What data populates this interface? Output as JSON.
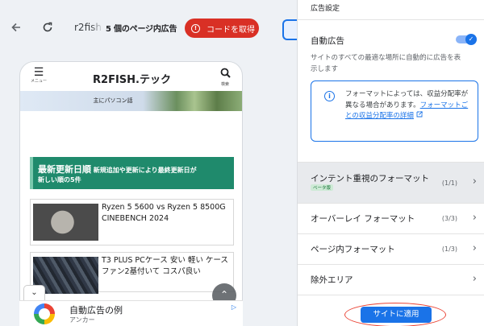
{
  "toolbar": {
    "back_icon": "arrow-left-icon",
    "reload_icon": "reload-icon",
    "url": "r2fish",
    "ads_count": "5 個のページ内広告",
    "get_code_label": "コードを取得",
    "get_code_color": "#d93025"
  },
  "site": {
    "menu_label": "メニュー",
    "title": "R2FISH.テック",
    "search_label": "検索",
    "banner_text": "主にパソコン話",
    "section_heading_big": "最新更新日順",
    "section_heading_rest": " 新規追加や更新により最終更新日が",
    "section_heading_line2": "新しい順の5件",
    "articles": [
      {
        "title": "Ryzen 5 5600 vs Ryzen 5 8500G CINEBENCH 2024"
      },
      {
        "title": "T3 PLUS PCケース 安い 軽い ケースファン2基付いて コスパ良い"
      }
    ]
  },
  "ad": {
    "title": "自動広告の例",
    "sub": "アンカー",
    "choice_glyph": "▷"
  },
  "panel": {
    "title": "広告設定",
    "auto_ads_label": "自動広告",
    "auto_ads_enabled": true,
    "auto_ads_desc": "サイトのすべての最適な場所に自動的に広告を表示します",
    "info_text": "フォーマットによっては、収益分配率が異なる場合があります。",
    "info_link": "フォーマットごとの収益分配率の詳細",
    "formats": [
      {
        "label": "インテント重視のフォーマット",
        "count": "(1/1)",
        "badge": "ベータ版",
        "active": true
      },
      {
        "label": "オーバーレイ フォーマット",
        "count": "(3/3)"
      },
      {
        "label": "ページ内フォーマット",
        "count": "(1/3)"
      },
      {
        "label": "除外エリア",
        "count": ""
      }
    ],
    "apply_label": "サイトに適用",
    "accent_color": "#1a73e8",
    "highlight_color": "#ea4335"
  }
}
